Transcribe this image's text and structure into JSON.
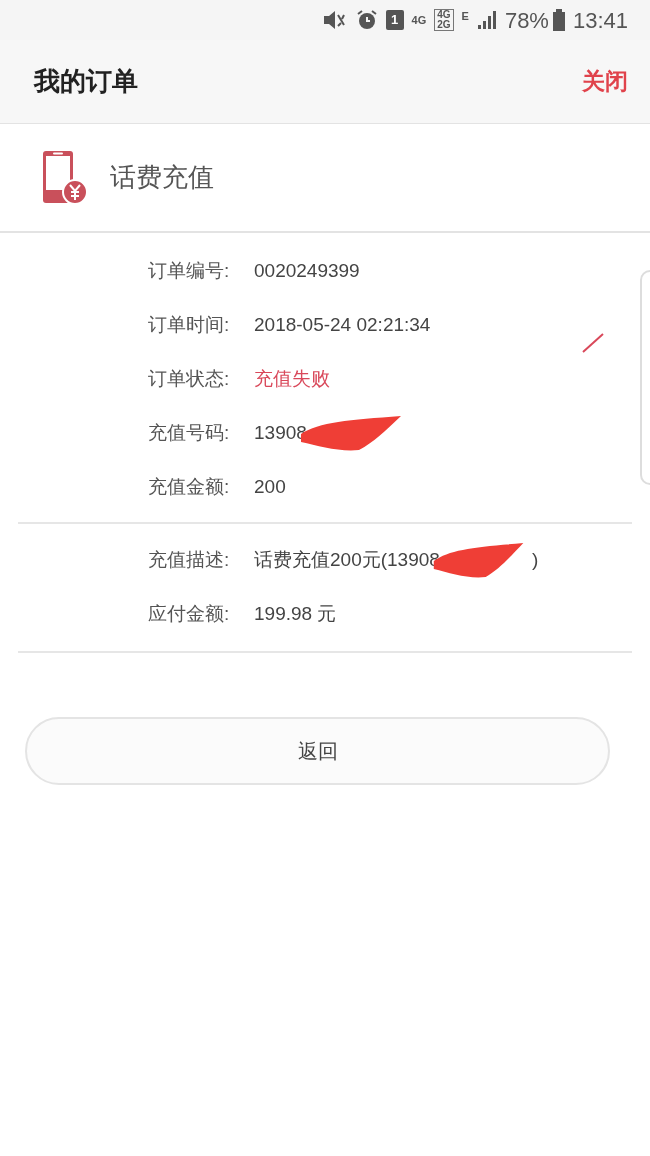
{
  "status_bar": {
    "sim_slot": "1",
    "network": "4G",
    "dual_network": [
      "4G",
      "2G"
    ],
    "data_type": "E",
    "battery": "78%",
    "time": "13:41"
  },
  "header": {
    "title": "我的订单",
    "close": "关闭"
  },
  "category": {
    "title": "话费充值"
  },
  "sections": [
    {
      "rows": [
        {
          "label": "订单编号:",
          "value": "0020249399",
          "kind": "plain"
        },
        {
          "label": "订单时间:",
          "value": "2018-05-24 02:21:34",
          "kind": "plain"
        },
        {
          "label": "订单状态:",
          "value": "充值失败",
          "kind": "status"
        },
        {
          "label": "充值号码:",
          "value": "13908",
          "kind": "redacted"
        },
        {
          "label": "充值金额:",
          "value": "200",
          "kind": "plain"
        }
      ]
    },
    {
      "rows": [
        {
          "label": "充值描述:",
          "value": "话费充值200元(13908",
          "value_end": ")",
          "kind": "redacted"
        },
        {
          "label": "应付金额:",
          "value": "199.98 元",
          "kind": "plain"
        }
      ]
    }
  ],
  "back_button": "返回"
}
